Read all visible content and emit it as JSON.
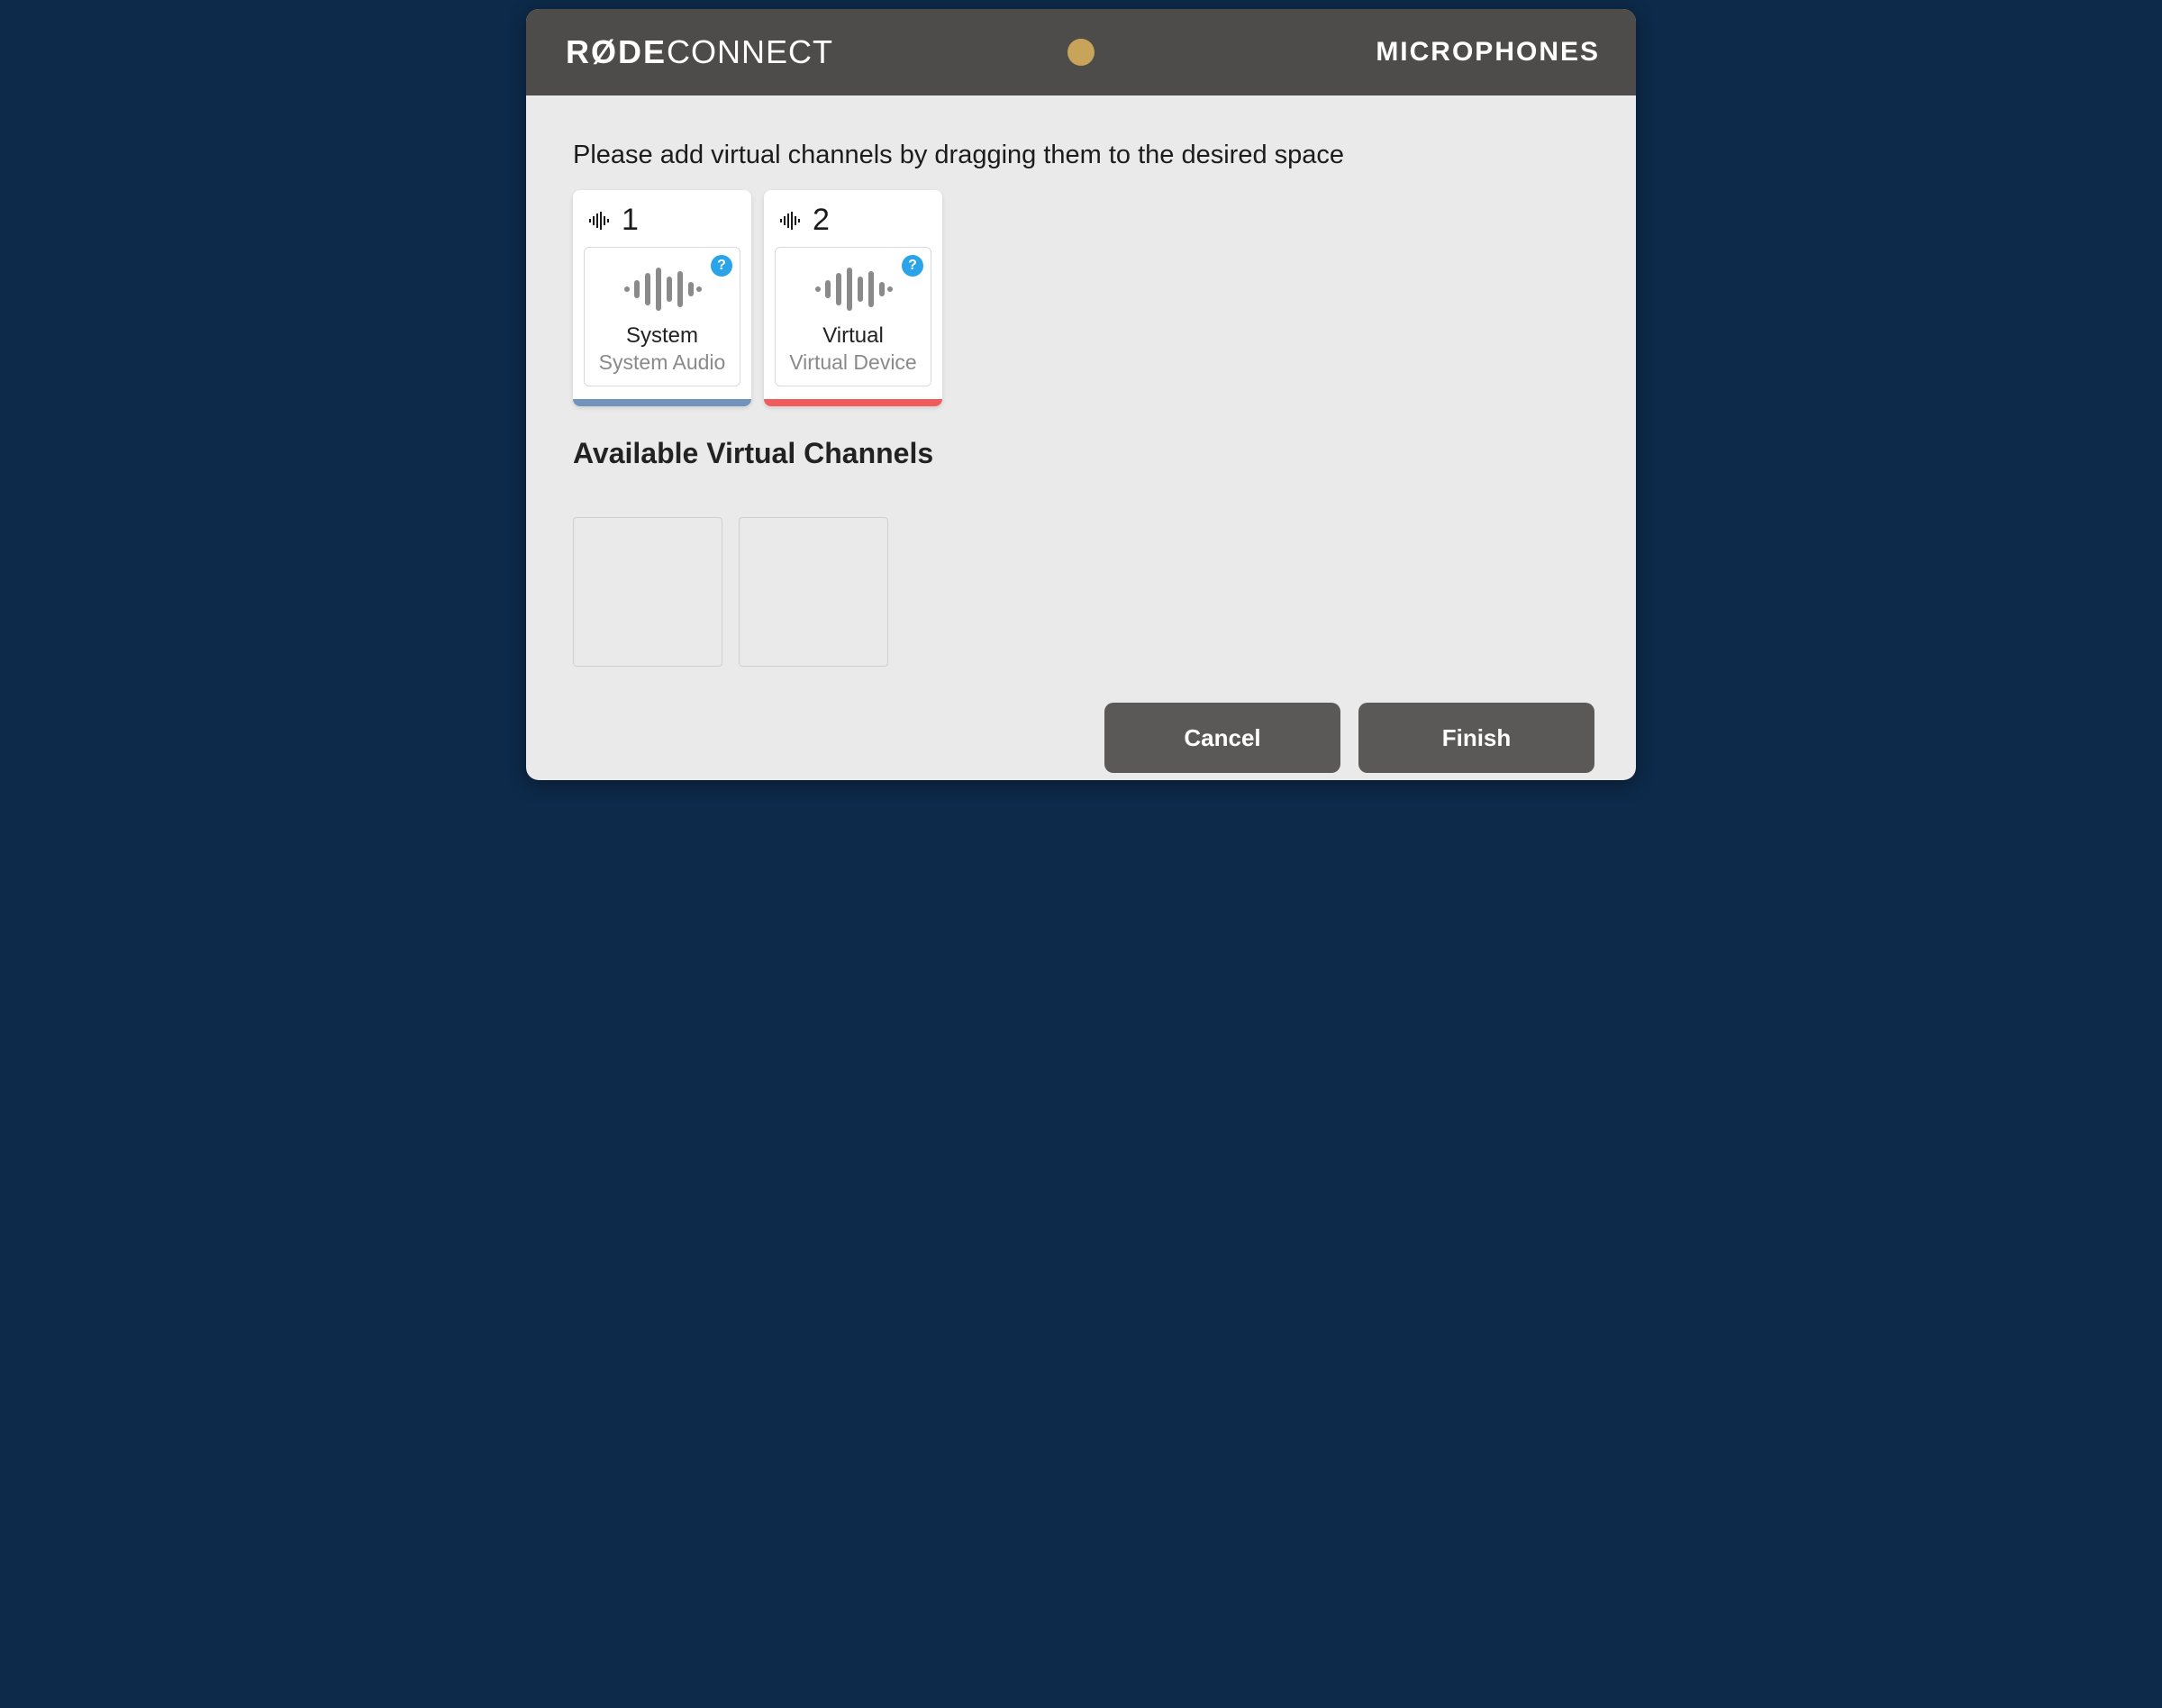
{
  "header": {
    "brand_bold": "RØDE",
    "brand_light": "CONNECT",
    "page_label": "MICROPHONES",
    "accent_dot_color": "#c8a45a"
  },
  "main": {
    "instruction": "Please add virtual channels by dragging them to the desired space",
    "slots": [
      {
        "number": "1",
        "device_name": "System",
        "device_sub": "System Audio",
        "stripe_color": "#6f93bb",
        "help_symbol": "?"
      },
      {
        "number": "2",
        "device_name": "Virtual",
        "device_sub": "Virtual Device",
        "stripe_color": "#f15b5b",
        "help_symbol": "?"
      }
    ],
    "available_title": "Available Virtual Channels",
    "available_slots": 2
  },
  "footer": {
    "cancel_label": "Cancel",
    "finish_label": "Finish"
  }
}
